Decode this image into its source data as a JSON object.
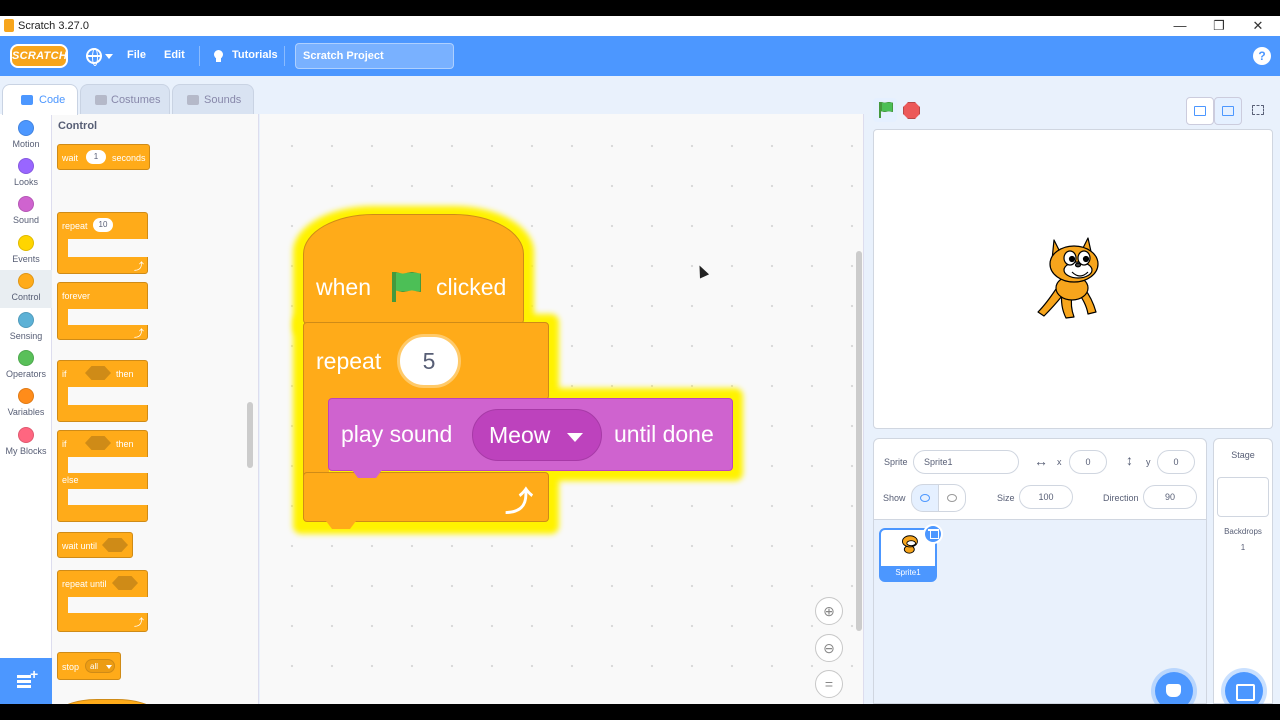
{
  "window": {
    "title": "Scratch 3.27.0",
    "min": "—",
    "restore": "❐",
    "close": "✕"
  },
  "menu": {
    "logo": "SCRATCH",
    "file": "File",
    "edit": "Edit",
    "tutorials": "Tutorials",
    "project_title": "Scratch Project",
    "help": "?"
  },
  "tabs": [
    {
      "label": "Code"
    },
    {
      "label": "Costumes"
    },
    {
      "label": "Sounds"
    }
  ],
  "categories": [
    {
      "label": "Motion",
      "color": "#4c97ff"
    },
    {
      "label": "Looks",
      "color": "#9966ff"
    },
    {
      "label": "Sound",
      "color": "#cf63cf"
    },
    {
      "label": "Events",
      "color": "#ffd500"
    },
    {
      "label": "Control",
      "color": "#ffab19"
    },
    {
      "label": "Sensing",
      "color": "#5cb1d6"
    },
    {
      "label": "Operators",
      "color": "#59c059"
    },
    {
      "label": "Variables",
      "color": "#ff8c1a"
    },
    {
      "label": "My Blocks",
      "color": "#ff6680"
    }
  ],
  "palette": {
    "title": "Control",
    "wait": "wait",
    "wait_value": "1",
    "seconds": "seconds",
    "repeat": "repeat",
    "repeat_value": "10",
    "forever": "forever",
    "if": "if",
    "then": "then",
    "if2": "if",
    "then2": "then",
    "else": "else",
    "wait_until": "wait until",
    "repeat_until": "repeat until",
    "stop": "stop",
    "stop_value": "all",
    "loop_arrow": "⤴"
  },
  "script": {
    "when": "when",
    "clicked": "clicked",
    "repeat": "repeat",
    "repeat_value": "5",
    "play_sound": "play sound",
    "sound_name": "Meow",
    "until_done": "until done",
    "loop_arrow": "⤴"
  },
  "zoom": {
    "in": "⊕",
    "out": "⊖",
    "reset": "="
  },
  "sprite_info": {
    "sprite_label": "Sprite",
    "sprite_name": "Sprite1",
    "x_label": "x",
    "x_value": "0",
    "y_label": "y",
    "y_value": "0",
    "show_label": "Show",
    "size_label": "Size",
    "size_value": "100",
    "direction_label": "Direction",
    "direction_value": "90"
  },
  "sprites": [
    {
      "name": "Sprite1"
    }
  ],
  "stage_panel": {
    "title": "Stage",
    "backdrops_label": "Backdrops",
    "backdrops_count": "1"
  }
}
